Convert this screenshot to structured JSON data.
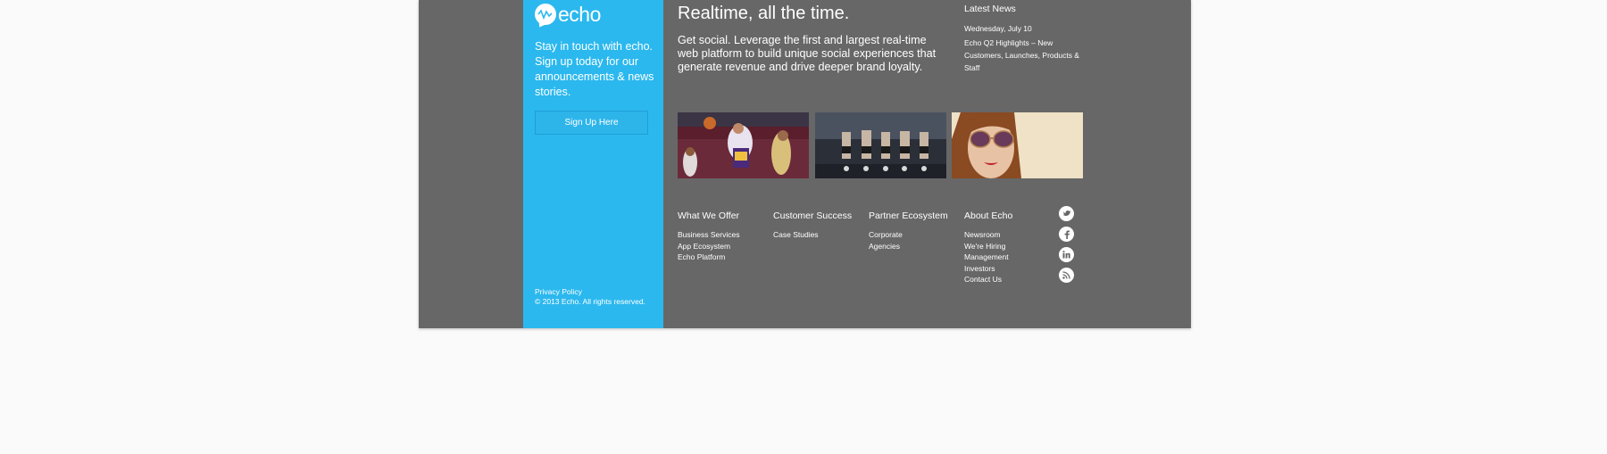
{
  "brand": {
    "logo_text": "echo",
    "accent_color": "#2bb8ee",
    "footer_bg": "#676767"
  },
  "signup": {
    "tagline": "Stay in touch with echo. Sign up today for our announcements & news stories.",
    "button_label": "Sign Up Here"
  },
  "legal": {
    "privacy_label": "Privacy Policy",
    "copyright": "© 2013 Echo. All rights reserved."
  },
  "hero": {
    "headline": "Realtime, all the time.",
    "intro": "Get social. Leverage the first and largest real-time web platform to build unique social experiences that generate revenue and drive deeper brand loyalty."
  },
  "news": {
    "title": "Latest News",
    "date": "Wednesday, July 10",
    "headline": "Echo Q2 Highlights – New Customers, Launches, Products & Staff"
  },
  "thumbnails": [
    {
      "icon": "basketball-photo"
    },
    {
      "icon": "wrestlers-lineup-photo"
    },
    {
      "icon": "woman-sunglasses-photo"
    }
  ],
  "columns": [
    {
      "title": "What We Offer",
      "links": [
        "Business Services",
        "App Ecosystem",
        "Echo Platform"
      ]
    },
    {
      "title": "Customer Success",
      "links": [
        "Case Studies"
      ]
    },
    {
      "title": "Partner Ecosystem",
      "links": [
        "Corporate",
        "Agencies"
      ]
    },
    {
      "title": "About Echo",
      "links": [
        "Newsroom",
        "We're Hiring",
        "Management",
        "Investors",
        "Contact Us"
      ]
    }
  ],
  "social": [
    {
      "icon": "twitter-icon"
    },
    {
      "icon": "facebook-icon"
    },
    {
      "icon": "linkedin-icon"
    },
    {
      "icon": "rss-icon"
    }
  ]
}
